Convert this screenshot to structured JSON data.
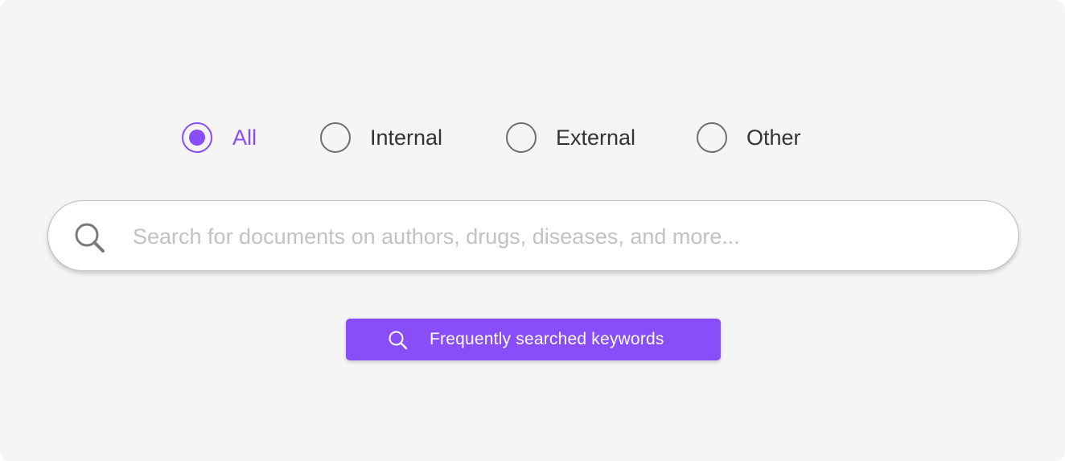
{
  "filters": {
    "options": [
      {
        "label": "All",
        "selected": true
      },
      {
        "label": "Internal",
        "selected": false
      },
      {
        "label": "External",
        "selected": false
      },
      {
        "label": "Other",
        "selected": false
      }
    ]
  },
  "search": {
    "value": "",
    "placeholder": "Search for documents on authors, drugs, diseases, and more...",
    "icon": "search-icon"
  },
  "keywords_button": {
    "label": "Frequently searched keywords",
    "icon": "search-icon"
  },
  "colors": {
    "accent": "#8a4dfa",
    "background": "#f5f5f5",
    "text": "#333333",
    "placeholder": "#c2c2c2",
    "radio_border": "#6e6e6e"
  }
}
